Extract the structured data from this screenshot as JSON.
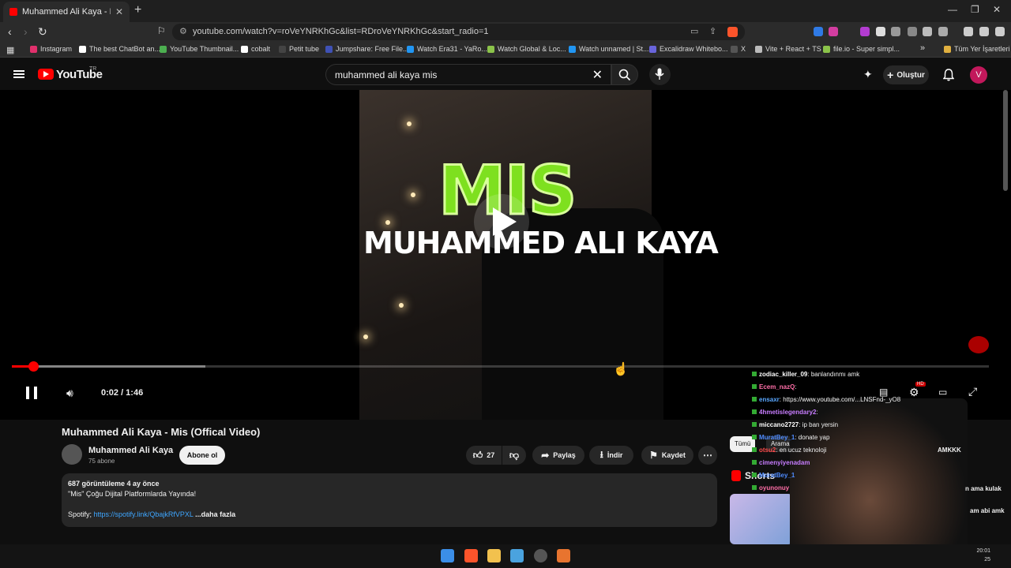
{
  "browser": {
    "tab_title": "Muhammed Ali Kaya - Mis (Offic",
    "tab_close": "✕",
    "new_tab": "+",
    "url": "youtube.com/watch?v=roVeYNRKhGc&list=RDroVeYNRKhGc&start_radio=1",
    "bookmarks": [
      {
        "label": "Instagram",
        "color": "#e1306c"
      },
      {
        "label": "The best ChatBot an...",
        "color": "#ffffff"
      },
      {
        "label": "YouTube Thumbnail...",
        "color": "#4caf50"
      },
      {
        "label": "cobalt",
        "color": "#ffffff"
      },
      {
        "label": "Petit tube",
        "color": "#111111"
      },
      {
        "label": "Jumpshare: Free File...",
        "color": "#3f51b5"
      },
      {
        "label": "Watch Era31 - YaRo...",
        "color": "#2196f3"
      },
      {
        "label": "Watch Global & Loc...",
        "color": "#8bc34a"
      },
      {
        "label": "Watch unnamed | St...",
        "color": "#2196f3"
      },
      {
        "label": "Excalidraw Whitebo...",
        "color": "#6965db"
      },
      {
        "label": "X",
        "color": "#000000"
      },
      {
        "label": "Vite + React + TS",
        "color": "#bbbbbb"
      },
      {
        "label": "file.io - Super simpl...",
        "color": "#8bc34a"
      }
    ],
    "bookmarks_more": "»",
    "all_bookmarks": "Tüm Yer İşaretleri"
  },
  "youtube": {
    "logo_text": "YouTube",
    "country": "TR",
    "search_value": "muhammed ali kaya mis",
    "create_label": "Oluştur",
    "avatar_letter": "V"
  },
  "video": {
    "overlay_title": "MIS",
    "overlay_subtitle": "MUHAMMED ALI KAYA",
    "time": "0:02 / 1:46",
    "progress_fraction": 0.022,
    "buffered_fraction": 0.198,
    "hd_badge": "HD"
  },
  "chat": [
    {
      "user": "zodiac_killer_09",
      "text": ": banlandınmı amk",
      "color": "#ffffff"
    },
    {
      "user": "Ecem_nazQ",
      "text": ":",
      "color": "#ff6fa8"
    },
    {
      "user": "ensaxr",
      "text": ": https://www.youtube.com/...LNSFnd-_yO8",
      "color": "#59a7ff"
    },
    {
      "user": "4hmetislegendary2",
      "text": ":",
      "color": "#c77dff"
    },
    {
      "user": "miccano2727",
      "text": ": ip ban yersin",
      "color": "#ffffff"
    },
    {
      "user": "MuratBey_1",
      "text": ": donate yap",
      "color": "#4f8cff"
    },
    {
      "user": "otsu2",
      "text": ": en ucuz teknoloji",
      "color": "#ff4d4d"
    },
    {
      "user": "cimenyiyenadam",
      "text": "",
      "color": "#c77dff"
    },
    {
      "user": "MuratBey_1",
      "text": "",
      "color": "#4f8cff"
    },
    {
      "user": "oyunonuy",
      "text": "",
      "color": "#ff6fa8"
    }
  ],
  "chat_right": [
    {
      "text": "AMKKK"
    },
    {
      "text": "n ama kulak"
    },
    {
      "text": "am abi amk"
    }
  ],
  "details": {
    "title": "Muhammed Ali Kaya - Mis (Offical Video)",
    "channel": "Muhammed Ali Kaya",
    "subscribers": "75 abone",
    "subscribe_label": "Abone ol",
    "likes": "27",
    "share_label": "Paylaş",
    "download_label": "İndir",
    "save_label": "Kaydet",
    "views_line": "687 görüntüleme  4 ay önce",
    "desc_line1": "\"Mis\" Çoğu Dijital Platformlarda Yayında!",
    "spotify_prefix": "Spotify; ",
    "spotify_link": "https://spotify.link/QbajkRfVPXL",
    "more_label": "...daha fazla"
  },
  "sidebar": {
    "chips": [
      "Tümü",
      "Aramanızdan"
    ],
    "shorts_label": "Shorts"
  },
  "taskbar": {
    "clock_time": "20:01",
    "clock_date": "25"
  }
}
